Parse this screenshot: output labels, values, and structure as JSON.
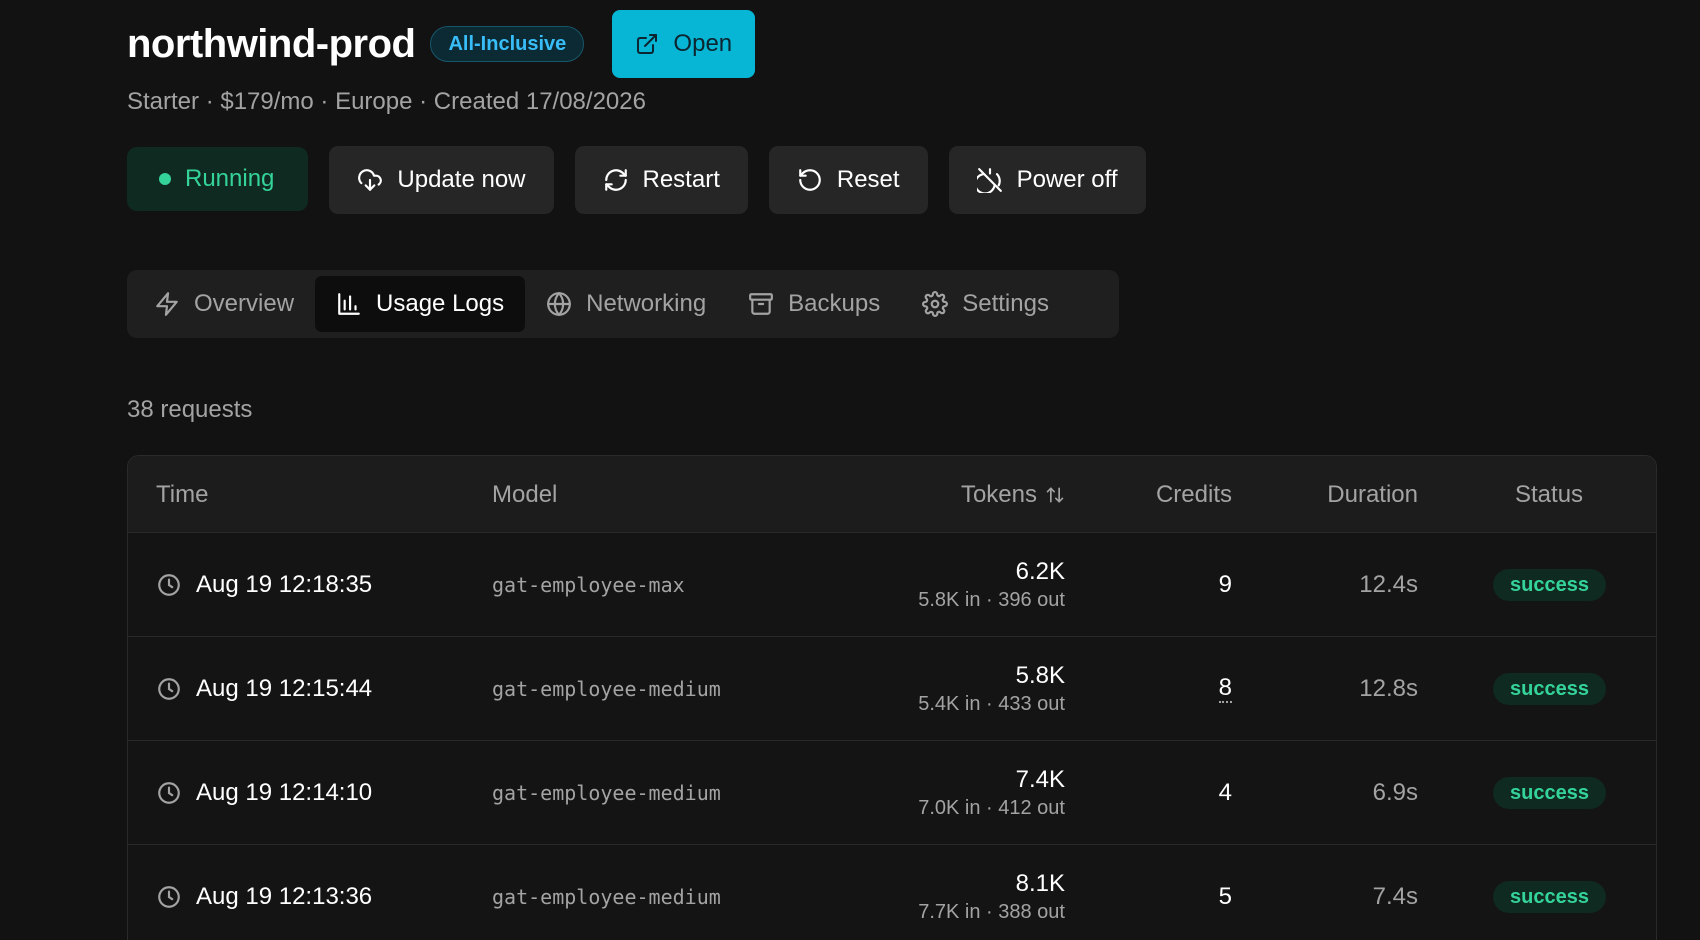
{
  "header": {
    "title": "northwind-prod",
    "plan_badge": "All-Inclusive",
    "open_label": "Open",
    "subtitle": "Starter · $179/mo · Europe · Created 17/08/2026"
  },
  "actions": {
    "status": "Running",
    "update": "Update now",
    "restart": "Restart",
    "reset": "Reset",
    "power_off": "Power off"
  },
  "tabs": [
    {
      "label": "Overview",
      "icon": "lightning-icon"
    },
    {
      "label": "Usage Logs",
      "icon": "bar-chart-icon",
      "active": true
    },
    {
      "label": "Networking",
      "icon": "globe-icon"
    },
    {
      "label": "Backups",
      "icon": "archive-icon"
    },
    {
      "label": "Settings",
      "icon": "gear-icon"
    }
  ],
  "request_count": "38 requests",
  "table": {
    "headers": {
      "time": "Time",
      "model": "Model",
      "tokens": "Tokens",
      "credits": "Credits",
      "duration": "Duration",
      "status": "Status"
    },
    "rows": [
      {
        "time": "Aug 19 12:18:35",
        "model": "gat-employee-max",
        "tokens": "6.2K",
        "tokens_detail": "5.8K in · 396 out",
        "credits": "9",
        "duration": "12.4s",
        "status": "success"
      },
      {
        "time": "Aug 19 12:15:44",
        "model": "gat-employee-medium",
        "tokens": "5.8K",
        "tokens_detail": "5.4K in · 433 out",
        "credits": "8",
        "duration": "12.8s",
        "status": "success"
      },
      {
        "time": "Aug 19 12:14:10",
        "model": "gat-employee-medium",
        "tokens": "7.4K",
        "tokens_detail": "7.0K in · 412 out",
        "credits": "4",
        "duration": "6.9s",
        "status": "success"
      },
      {
        "time": "Aug 19 12:13:36",
        "model": "gat-employee-medium",
        "tokens": "8.1K",
        "tokens_detail": "7.7K in · 388 out",
        "credits": "5",
        "duration": "7.4s",
        "status": "success"
      }
    ]
  },
  "colors": {
    "accent": "#06b6d4",
    "success": "#34d399",
    "badge_text": "#38bdf8",
    "background": "#121212"
  }
}
